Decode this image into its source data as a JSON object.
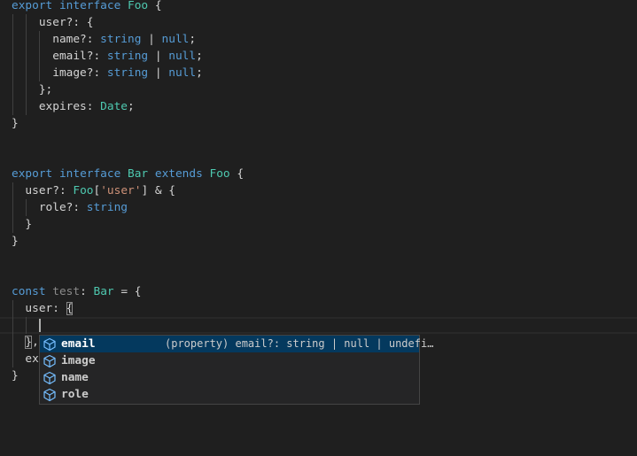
{
  "editor": {
    "lines": {
      "l1": {
        "export": "export",
        "interface": "interface",
        "name": "Foo",
        "open": " {"
      },
      "l2": {
        "prop": "user?: ",
        "open": "{"
      },
      "l3": {
        "prop": "name?: ",
        "type1": "string",
        "pipe": " | ",
        "type2": "null",
        "end": ";"
      },
      "l4": {
        "prop": "email?: ",
        "type1": "string",
        "pipe": " | ",
        "type2": "null",
        "end": ";"
      },
      "l5": {
        "prop": "image?: ",
        "type1": "string",
        "pipe": " | ",
        "type2": "null",
        "end": ";"
      },
      "l6": {
        "text": "};"
      },
      "l7": {
        "prop": "expires: ",
        "type": "Date",
        "end": ";"
      },
      "l8": {
        "text": "}"
      },
      "l11": {
        "export": "export",
        "interface": "interface",
        "name": "Bar",
        "extends": "extends",
        "base": "Foo",
        "open": " {"
      },
      "l12": {
        "prop": "user?: ",
        "type": "Foo",
        "lb": "[",
        "str": "'user'",
        "rb": "]",
        "amp": " & {"
      },
      "l13": {
        "prop": "role?: ",
        "type": "string"
      },
      "l14": {
        "text": "}"
      },
      "l15": {
        "text": "}"
      },
      "l18": {
        "const": "const",
        "name": "test",
        "colon": ": ",
        "type": "Bar",
        "rest": " = {"
      },
      "l19": {
        "prop": "user: ",
        "open": "{"
      },
      "l21": {
        "close": "}",
        "comma": ","
      },
      "l22": {
        "text": "ex"
      },
      "l23": {
        "text": "}"
      }
    }
  },
  "suggest": {
    "items": [
      {
        "label": "email",
        "icon": "property-icon",
        "detail": "(property) email?: string | null | undefi…"
      },
      {
        "label": "image",
        "icon": "property-icon",
        "detail": ""
      },
      {
        "label": "name",
        "icon": "property-icon",
        "detail": ""
      },
      {
        "label": "role",
        "icon": "property-icon",
        "detail": ""
      }
    ],
    "selected_index": 0
  },
  "colors": {
    "background": "#1f1f1f",
    "keyword": "#569cd6",
    "type": "#4ec9b0",
    "string": "#ce9178",
    "selection": "#04395e",
    "property_icon": "#75beff"
  }
}
